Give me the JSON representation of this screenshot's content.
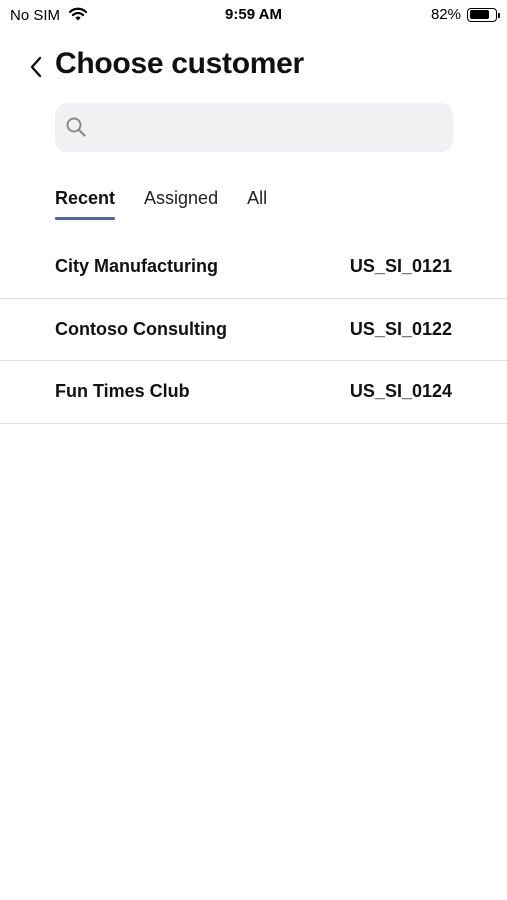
{
  "status_bar": {
    "carrier": "No SIM",
    "time": "9:59 AM",
    "battery_text": "82%",
    "battery_level": 0.82
  },
  "header": {
    "title": "Choose customer"
  },
  "search": {
    "placeholder": ""
  },
  "tabs": [
    {
      "label": "Recent",
      "active": true
    },
    {
      "label": "Assigned",
      "active": false
    },
    {
      "label": "All",
      "active": false
    }
  ],
  "customers": [
    {
      "name": "City Manufacturing",
      "id": "US_SI_0121"
    },
    {
      "name": "Contoso Consulting",
      "id": "US_SI_0122"
    },
    {
      "name": "Fun Times Club",
      "id": "US_SI_0124"
    }
  ],
  "colors": {
    "accent": "#4f64a8",
    "search_background": "#f1f1f3",
    "divider": "#dcdcdc"
  }
}
